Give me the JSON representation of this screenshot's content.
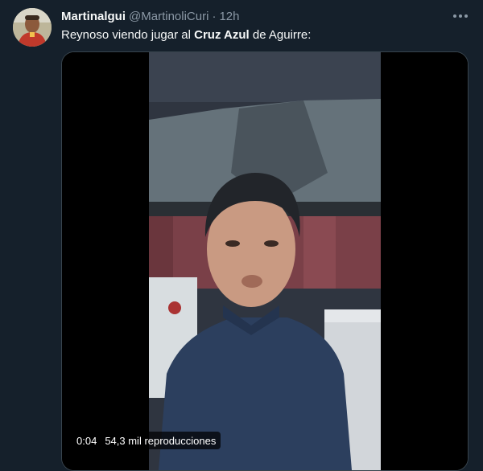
{
  "tweet": {
    "author_name": "Martinalgui",
    "author_handle": "@MartinoliCuri",
    "separator": "·",
    "time": "12h",
    "text_before": "Reynoso viendo jugar al ",
    "text_bold": "Cruz Azul",
    "text_after": " de Aguirre:"
  },
  "icons": {
    "more": "more-horizontal-icon",
    "avatar": "profile-avatar"
  },
  "video": {
    "elapsed": "0:04",
    "views": "54,3 mil reproducciones"
  },
  "colors": {
    "background": "#15202b",
    "secondary_text": "#8b98a5",
    "border": "#38444d"
  }
}
